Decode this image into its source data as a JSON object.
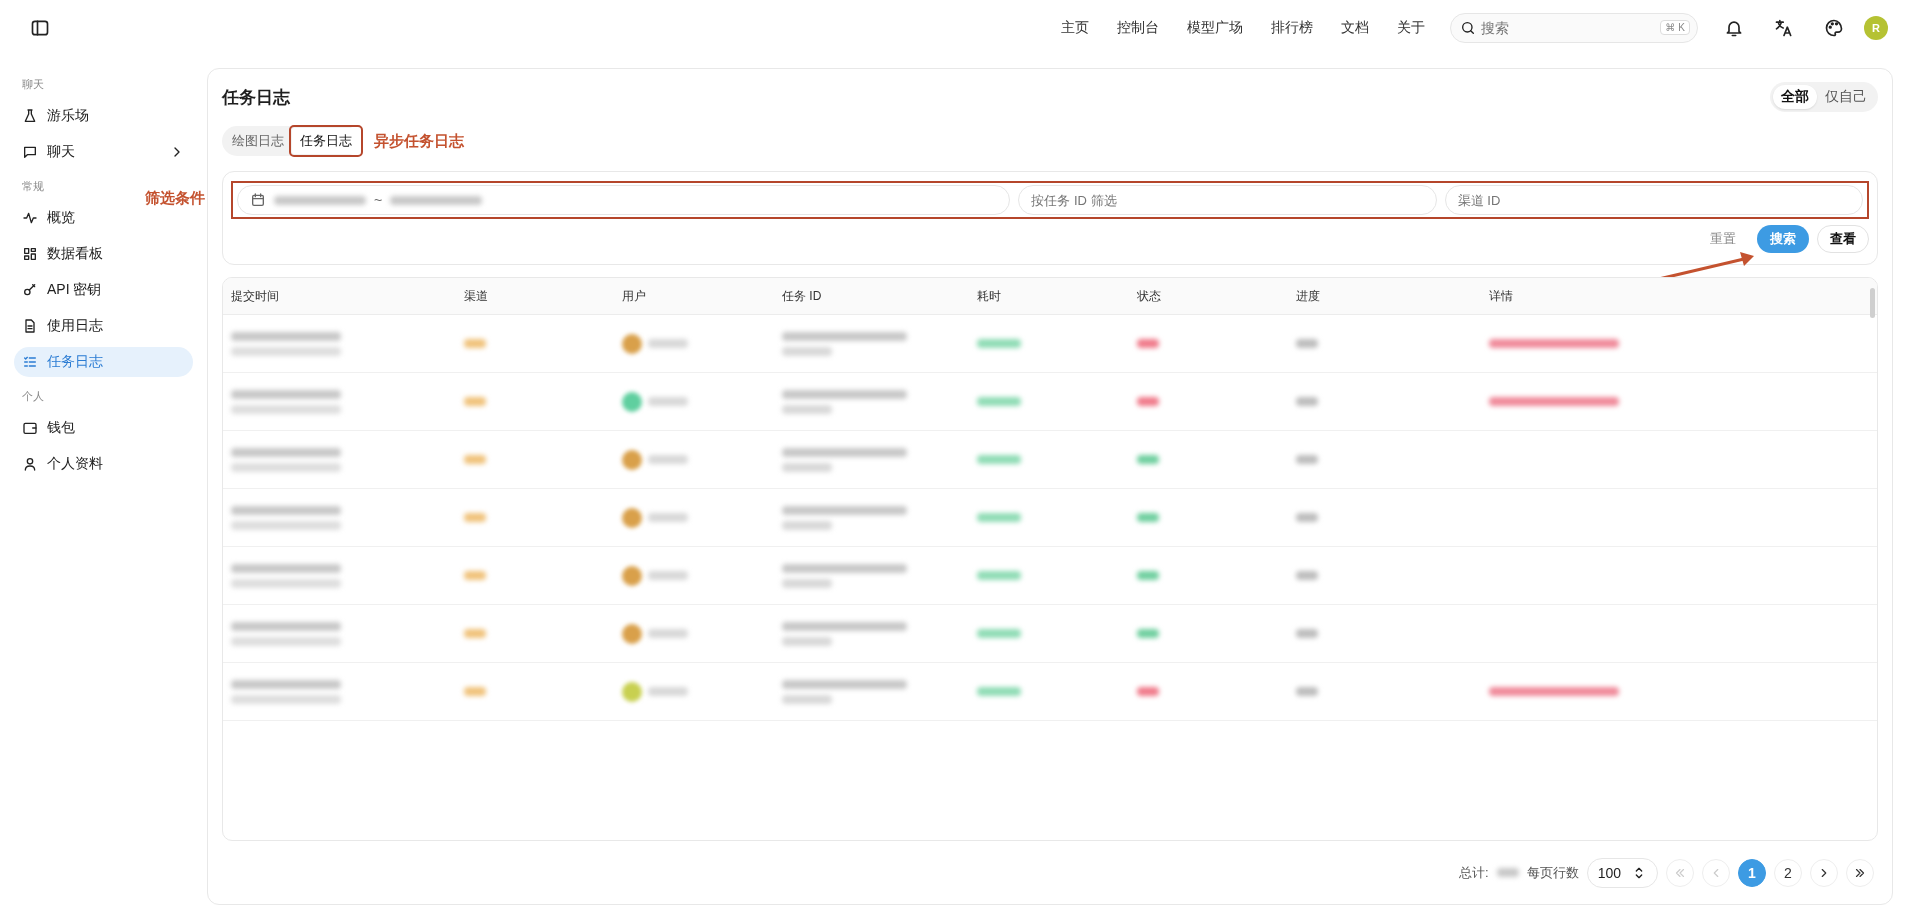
{
  "topbar": {
    "nav": [
      "主页",
      "控制台",
      "模型广场",
      "排行榜",
      "文档",
      "关于"
    ],
    "search": {
      "placeholder": "搜索",
      "shortcut_symbol": "⌘",
      "shortcut_key": "K"
    },
    "avatar": "R"
  },
  "sidebar": {
    "sections": [
      {
        "label": "聊天",
        "items": [
          {
            "label": "游乐场",
            "selected": false,
            "has_children": false
          },
          {
            "label": "聊天",
            "selected": false,
            "has_children": true
          }
        ]
      },
      {
        "label": "常规",
        "items": [
          {
            "label": "概览",
            "selected": false,
            "has_children": false
          },
          {
            "label": "数据看板",
            "selected": false,
            "has_children": false
          },
          {
            "label": "API 密钥",
            "selected": false,
            "has_children": false
          },
          {
            "label": "使用日志",
            "selected": false,
            "has_children": false
          },
          {
            "label": "任务日志",
            "selected": true,
            "has_children": false
          }
        ]
      },
      {
        "label": "个人",
        "items": [
          {
            "label": "钱包",
            "selected": false,
            "has_children": false
          },
          {
            "label": "个人资料",
            "selected": false,
            "has_children": false
          }
        ]
      }
    ]
  },
  "page": {
    "title": "任务日志",
    "scope": [
      {
        "label": "全部",
        "selected": true
      },
      {
        "label": "仅自己",
        "selected": false
      }
    ]
  },
  "tabs": [
    {
      "label": "绘图日志",
      "selected": false
    },
    {
      "label": "任务日志",
      "selected": true
    }
  ],
  "annotations": {
    "tab_note": "异步任务日志",
    "filter_note": "筛选条件"
  },
  "filters": {
    "date_separator": "~",
    "task_id": {
      "placeholder": "按任务 ID 筛选"
    },
    "channel_id": {
      "placeholder": "渠道 ID"
    },
    "buttons": [
      {
        "label": "重置",
        "kind": "text"
      },
      {
        "label": "搜索",
        "kind": "primary"
      },
      {
        "label": "查看",
        "kind": "outline"
      }
    ]
  },
  "table": {
    "columns": [
      "提交时间",
      "渠道",
      "用户",
      "任务 ID",
      "耗时",
      "状态",
      "进度",
      "详情"
    ],
    "rows": [
      {
        "kind": "failure",
        "color": "#d9a04a"
      },
      {
        "kind": "failure",
        "color": "#5fcf9f"
      },
      {
        "kind": "success",
        "color": "#d9a04a"
      },
      {
        "kind": "success",
        "color": "#d9a04a"
      },
      {
        "kind": "success",
        "color": "#d9a04a"
      },
      {
        "kind": "success",
        "color": "#d9a04a"
      },
      {
        "kind": "failure",
        "color": "#c8d050"
      }
    ]
  },
  "footer": {
    "total_label": "总计:",
    "page_size_label": "每页行数",
    "page_size": "100",
    "pages": [
      {
        "label": "1",
        "selected": true
      },
      {
        "label": "2",
        "selected": false
      }
    ]
  }
}
